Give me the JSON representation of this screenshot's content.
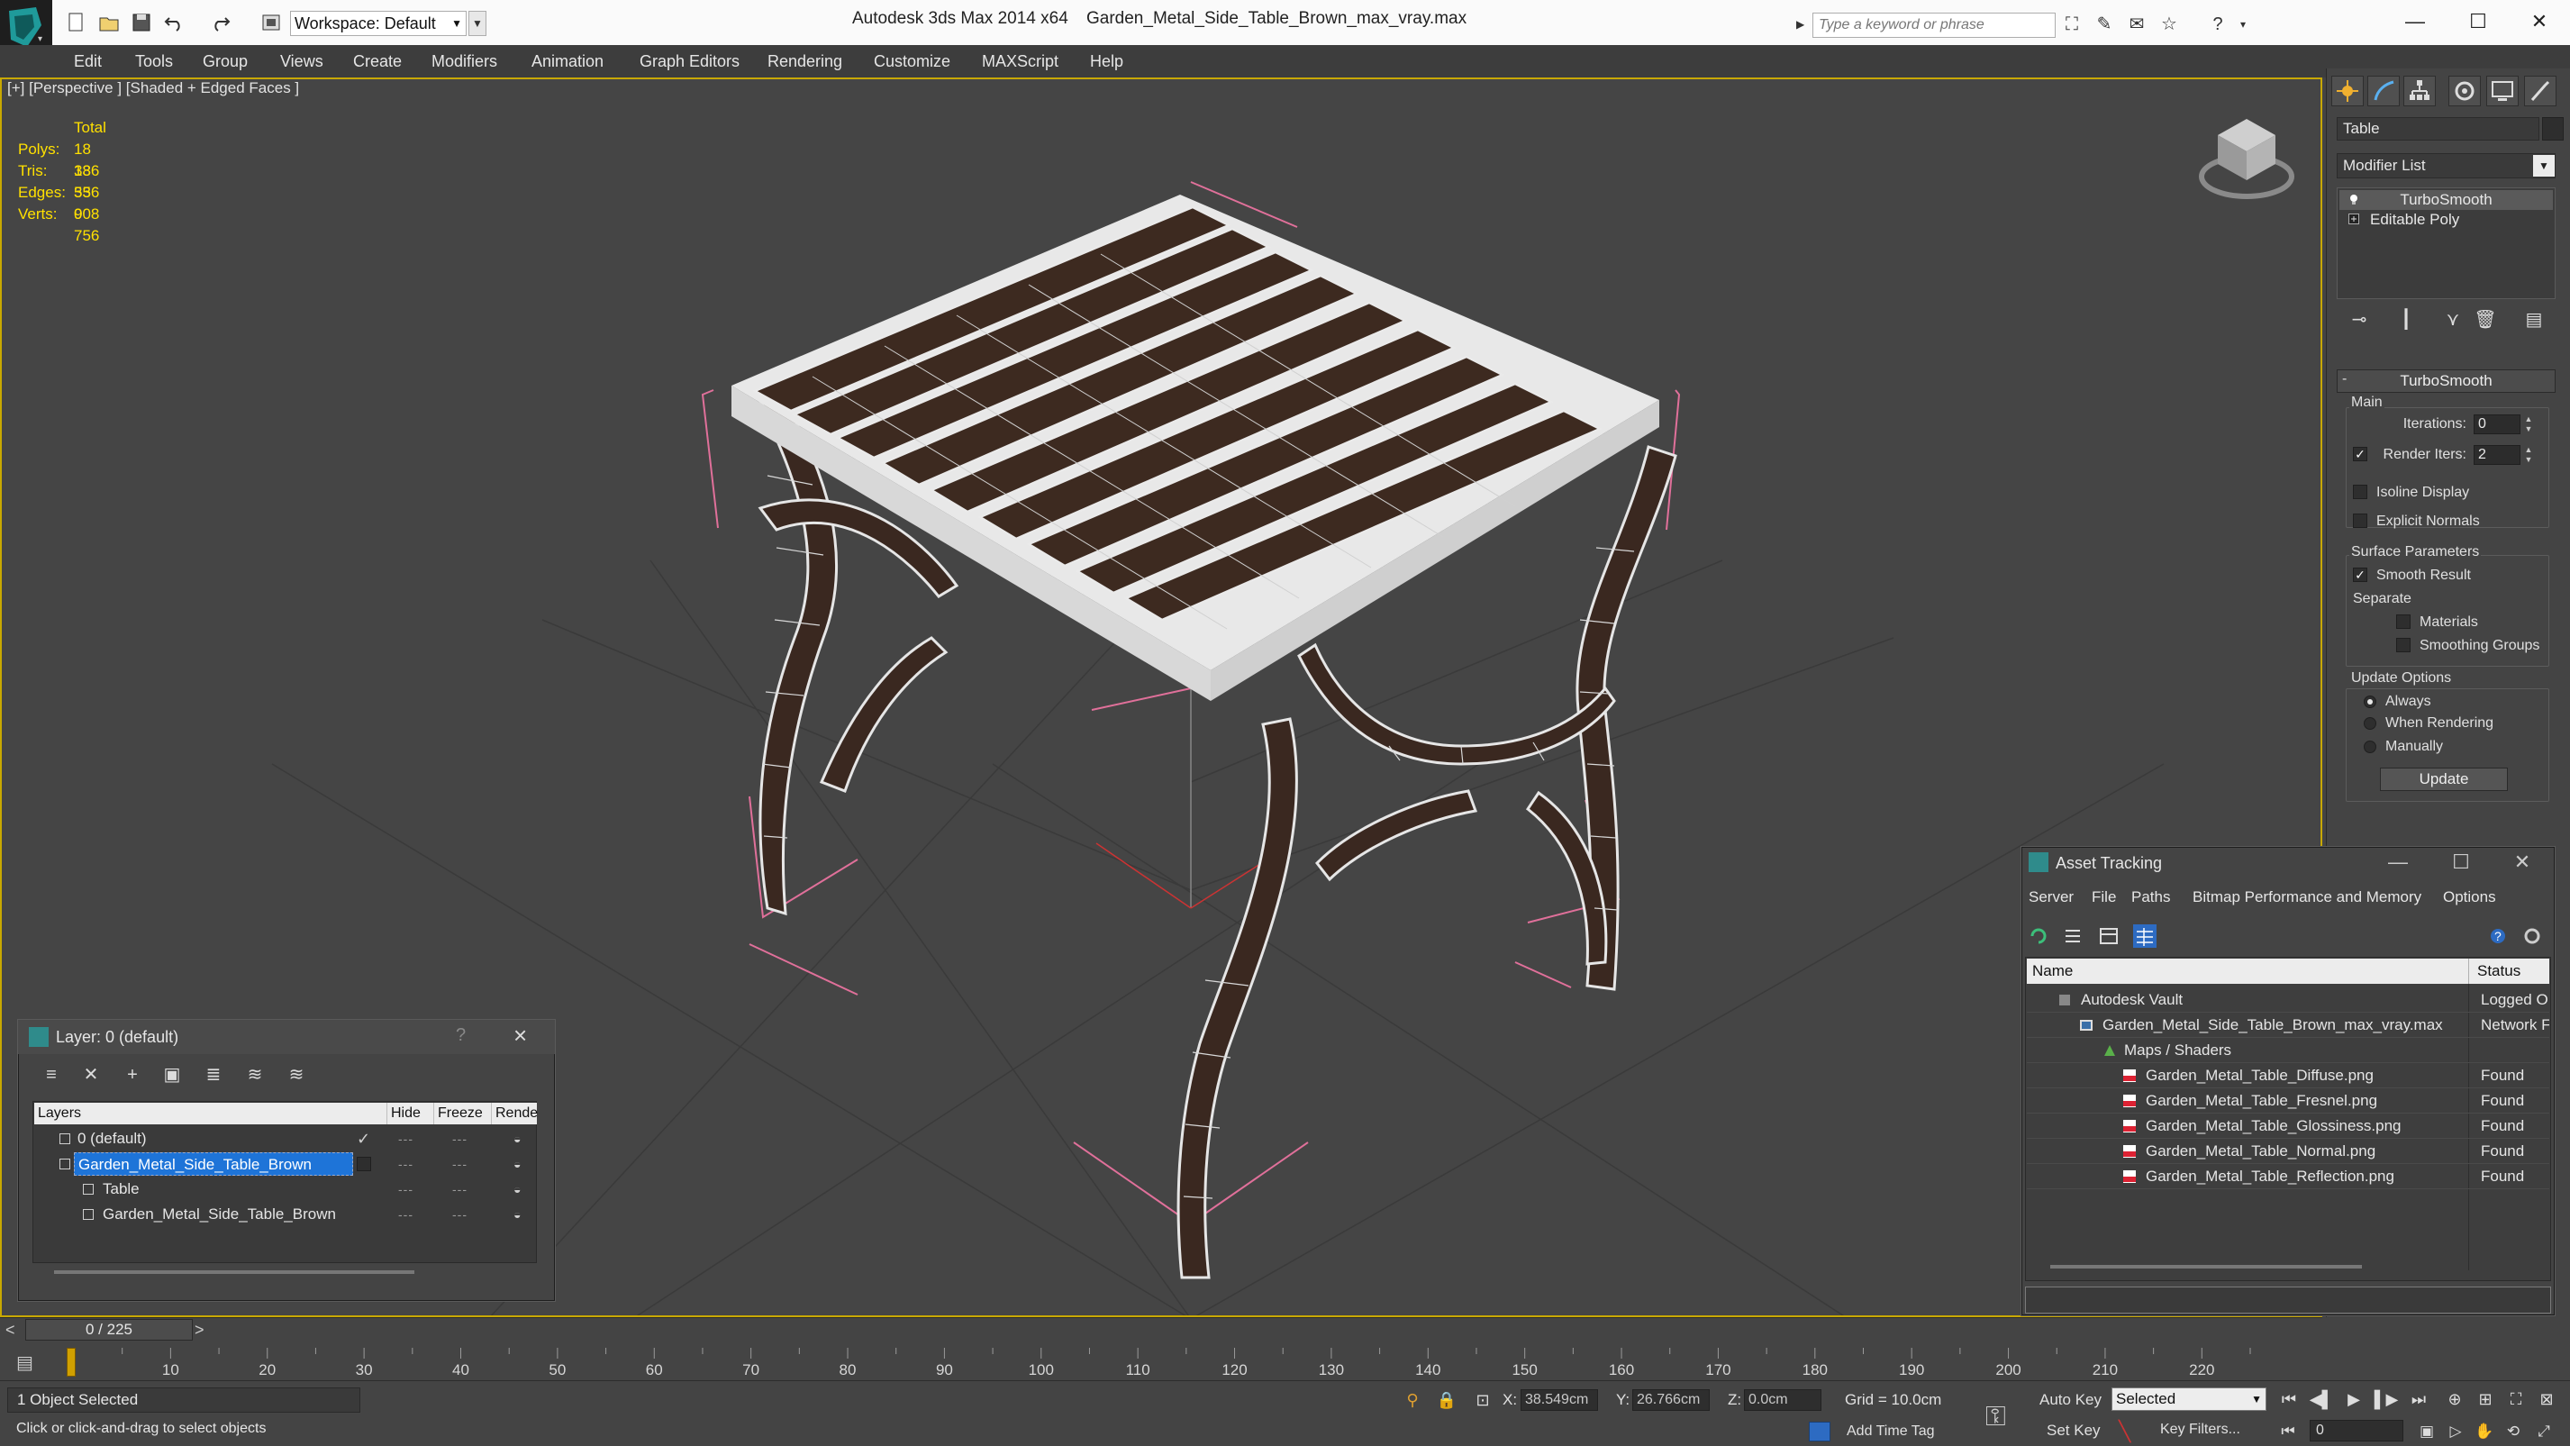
{
  "app": {
    "app_title": "Autodesk 3ds Max  2014 x64",
    "doc_title": "Garden_Metal_Side_Table_Brown_max_vray.max",
    "workspace": "Workspace: Default",
    "search_placeholder": "Type a keyword or phrase"
  },
  "menu": [
    "Edit",
    "Tools",
    "Group",
    "Views",
    "Create",
    "Modifiers",
    "Animation",
    "Graph Editors",
    "Rendering",
    "Customize",
    "MAXScript",
    "Help"
  ],
  "viewport": {
    "label": "[+] [Perspective ] [Shaded + Edged Faces ]",
    "stats_header": "Total",
    "stats": [
      {
        "label": "Polys:",
        "value": "18 336"
      },
      {
        "label": "Tris:",
        "value": "18 336"
      },
      {
        "label": "Edges:",
        "value": "55 008"
      },
      {
        "label": "Verts:",
        "value": "9 756"
      }
    ]
  },
  "command_panel": {
    "object_name": "Table",
    "modifier_list": "Modifier List",
    "stack": [
      "TurboSmooth",
      "Editable Poly"
    ],
    "rollout_title": "TurboSmooth",
    "main_group": "Main",
    "iterations_label": "Iterations:",
    "iterations_value": "0",
    "render_iters_label": "Render Iters:",
    "render_iters_value": "2",
    "isoline_label": "Isoline Display",
    "explicit_normals_label": "Explicit Normals",
    "surface_group": "Surface Parameters",
    "smooth_result_label": "Smooth Result",
    "separate_label": "Separate",
    "materials_label": "Materials",
    "smoothing_groups_label": "Smoothing Groups",
    "update_group": "Update Options",
    "always_label": "Always",
    "when_rendering_label": "When Rendering",
    "manually_label": "Manually",
    "update_button": "Update"
  },
  "layer_dialog": {
    "title": "Layer: 0 (default)",
    "help": "?",
    "columns": [
      "Layers",
      "Hide",
      "Freeze",
      "Rende"
    ],
    "rows": [
      {
        "name": "0 (default)",
        "indent": 1
      },
      {
        "name": "Garden_Metal_Side_Table_Brown",
        "indent": 1
      },
      {
        "name": "Table",
        "indent": 2
      },
      {
        "name": "Garden_Metal_Side_Table_Brown",
        "indent": 2
      }
    ]
  },
  "asset_dialog": {
    "title": "Asset Tracking",
    "menu": [
      "Server",
      "File",
      "Paths",
      "Bitmap Performance and Memory",
      "Options"
    ],
    "col_name": "Name",
    "col_status": "Status",
    "rows": [
      {
        "name": "Autodesk Vault",
        "status": "Logged O"
      },
      {
        "name": "Garden_Metal_Side_Table_Brown_max_vray.max",
        "status": "Network F"
      },
      {
        "name": "Maps / Shaders",
        "status": ""
      },
      {
        "name": "Garden_Metal_Table_Diffuse.png",
        "status": "Found"
      },
      {
        "name": "Garden_Metal_Table_Fresnel.png",
        "status": "Found"
      },
      {
        "name": "Garden_Metal_Table_Glossiness.png",
        "status": "Found"
      },
      {
        "name": "Garden_Metal_Table_Normal.png",
        "status": "Found"
      },
      {
        "name": "Garden_Metal_Table_Reflection.png",
        "status": "Found"
      }
    ]
  },
  "timeline": {
    "position": "0 / 225",
    "ticks": [
      "10",
      "20",
      "30",
      "40",
      "50",
      "60",
      "70",
      "80",
      "90",
      "100",
      "110",
      "120",
      "130",
      "140",
      "150",
      "160",
      "170",
      "180",
      "190",
      "200",
      "210",
      "220"
    ]
  },
  "status": {
    "selection": "1 Object Selected",
    "prompt": "Click or click-and-drag to select objects",
    "x_label": "X:",
    "x_value": "38.549cm",
    "y_label": "Y:",
    "y_value": "26.766cm",
    "z_label": "Z:",
    "z_value": "0.0cm",
    "grid": "Grid = 10.0cm",
    "add_time_tag": "Add Time Tag",
    "auto_key": "Auto Key",
    "set_key": "Set Key",
    "selected": "Selected",
    "key_filters": "Key Filters...",
    "frame": "0"
  },
  "colors": {
    "viewport_bg": "#454545",
    "stats_text": "#ffe000",
    "selection_highlight": "#1e74d8",
    "active_border": "#c8a800"
  }
}
